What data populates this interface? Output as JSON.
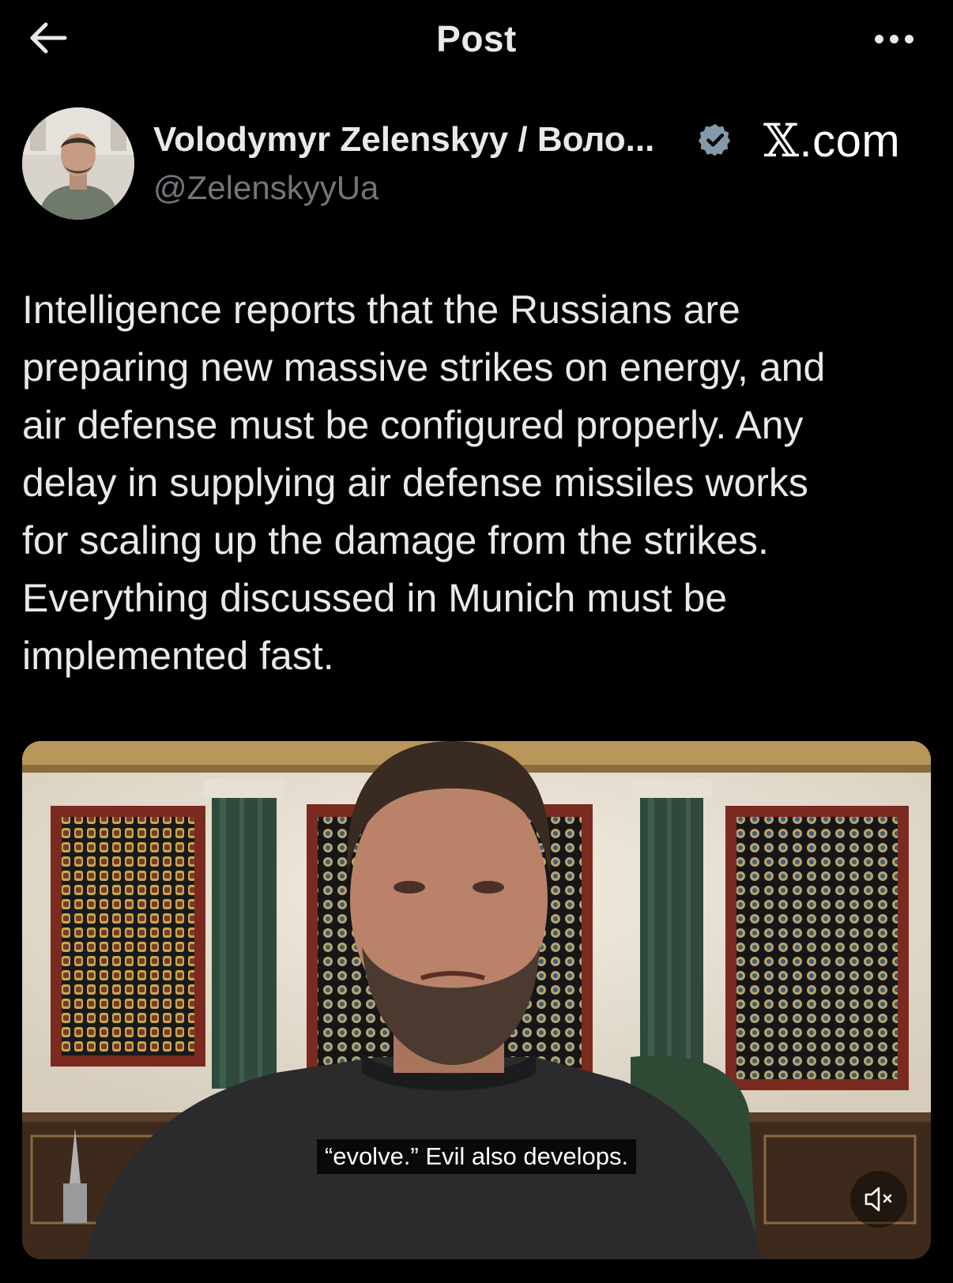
{
  "header": {
    "title": "Post",
    "back_icon": "arrow-left-icon",
    "more_icon": "more-horizontal-icon"
  },
  "author": {
    "name": "Volodymyr Zelenskyy / Воло...",
    "handle": "@ZelenskyyUa",
    "verified": true,
    "verified_color": "#829aab"
  },
  "watermark": {
    "x_glyph": "𝕏",
    "domain": ".com"
  },
  "post": {
    "text": "Intelligence reports that the Russians are\npreparing new massive strikes on energy, and\nair defense must be configured properly. Any\ndelay in supplying air defense missiles works\nfor scaling up the damage from the strikes.\nEverything discussed in Munich must be\nimplemented fast."
  },
  "video": {
    "caption": "“evolve.” Evil also develops.",
    "muted": true,
    "mute_icon": "volume-muted-icon"
  },
  "colors": {
    "background": "#000000",
    "text_primary": "#e7e9ea",
    "text_secondary": "#71767b"
  }
}
